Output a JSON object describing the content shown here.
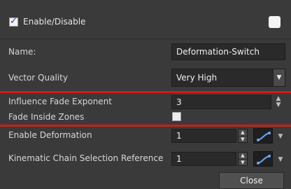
{
  "header": {
    "enable_label": "Enable/Disable",
    "enabled": true
  },
  "fields": {
    "name_label": "Name:",
    "name_value": "Deformation-Switch",
    "vector_quality_label": "Vector Quality",
    "vector_quality_value": "Very High",
    "influence_label": "Influence Fade Exponent",
    "influence_value": "3",
    "fade_label": "Fade Inside Zones",
    "enable_deformation_label": "Enable Deformation",
    "enable_deformation_value": "1",
    "kinematic_label": "Kinematic Chain Selection Reference",
    "kinematic_value": "1"
  },
  "buttons": {
    "close": "Close"
  },
  "colors": {
    "panel_bg": "#3a3a3a",
    "highlight_lines": "#cf1c1c"
  }
}
